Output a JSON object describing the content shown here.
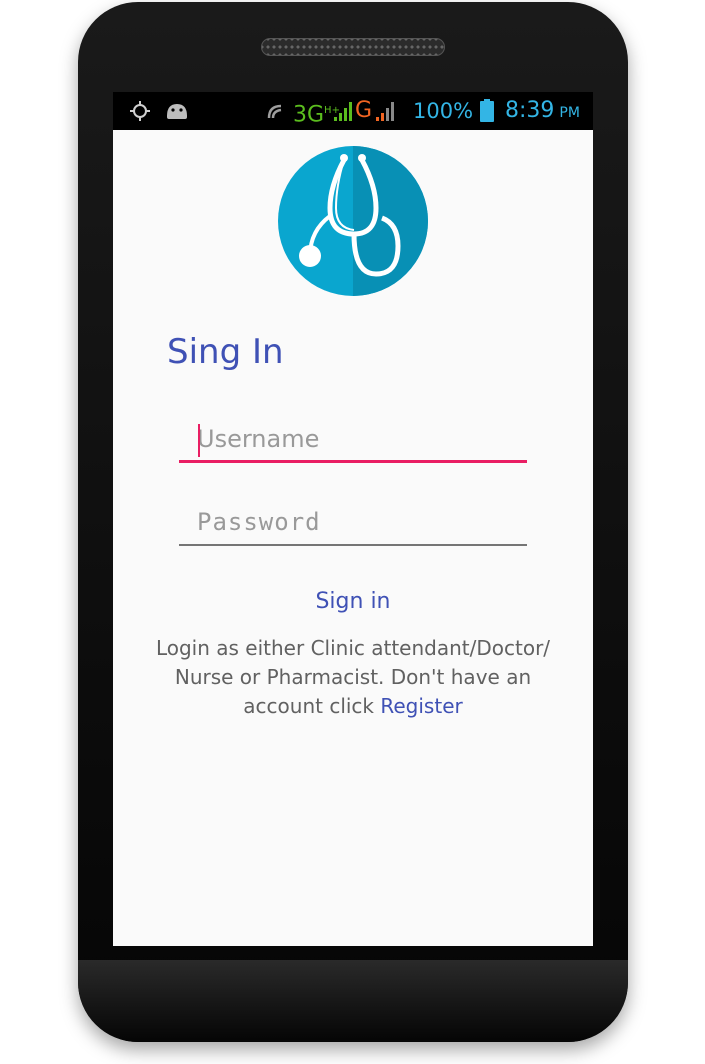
{
  "status_bar": {
    "icons": [
      "gps-icon",
      "android-icon",
      "phone-signal-icon"
    ],
    "network_primary": "3G",
    "network_primary_sup": "H+",
    "network_secondary": "G",
    "battery": "100%",
    "time": "8:39",
    "ampm": "PM",
    "colors": {
      "green": "#5bbd1e",
      "orange": "#f26522",
      "blue": "#33b5e5"
    }
  },
  "app": {
    "logo_icon": "stethoscope-icon",
    "title": "Sing In",
    "username_placeholder": "Username",
    "password_placeholder": "Password",
    "signin_label": "Sign in",
    "info_text": "Login as either Clinic attendant/Doctor/ Nurse or Pharmacist. Don't have an account click",
    "register_label": "Register",
    "colors": {
      "accent": "#3f51b5",
      "focus": "#e91e63",
      "logo": "#0aa6cf"
    }
  }
}
